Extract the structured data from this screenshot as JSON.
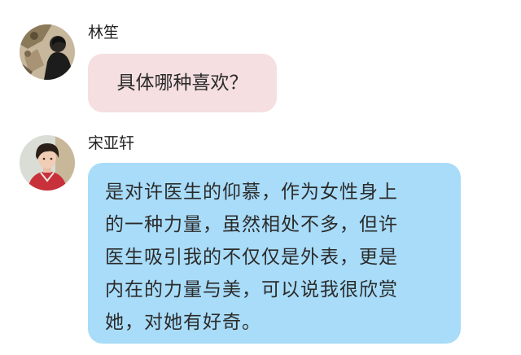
{
  "messages": [
    {
      "sender": "林笙",
      "text": "具体哪种喜欢？",
      "bubble_color": "#f5dfe0"
    },
    {
      "sender": "宋亚轩",
      "lines": [
        "是对许医生的仰慕，作为女性身上",
        "的一种力量，虽然相处不多，但许",
        "医生吸引我的不仅仅是外表，更是",
        "内在的力量与美，可以说我很欣赏",
        "她，对她有好奇。"
      ],
      "bubble_color": "#a8dcf9"
    }
  ]
}
